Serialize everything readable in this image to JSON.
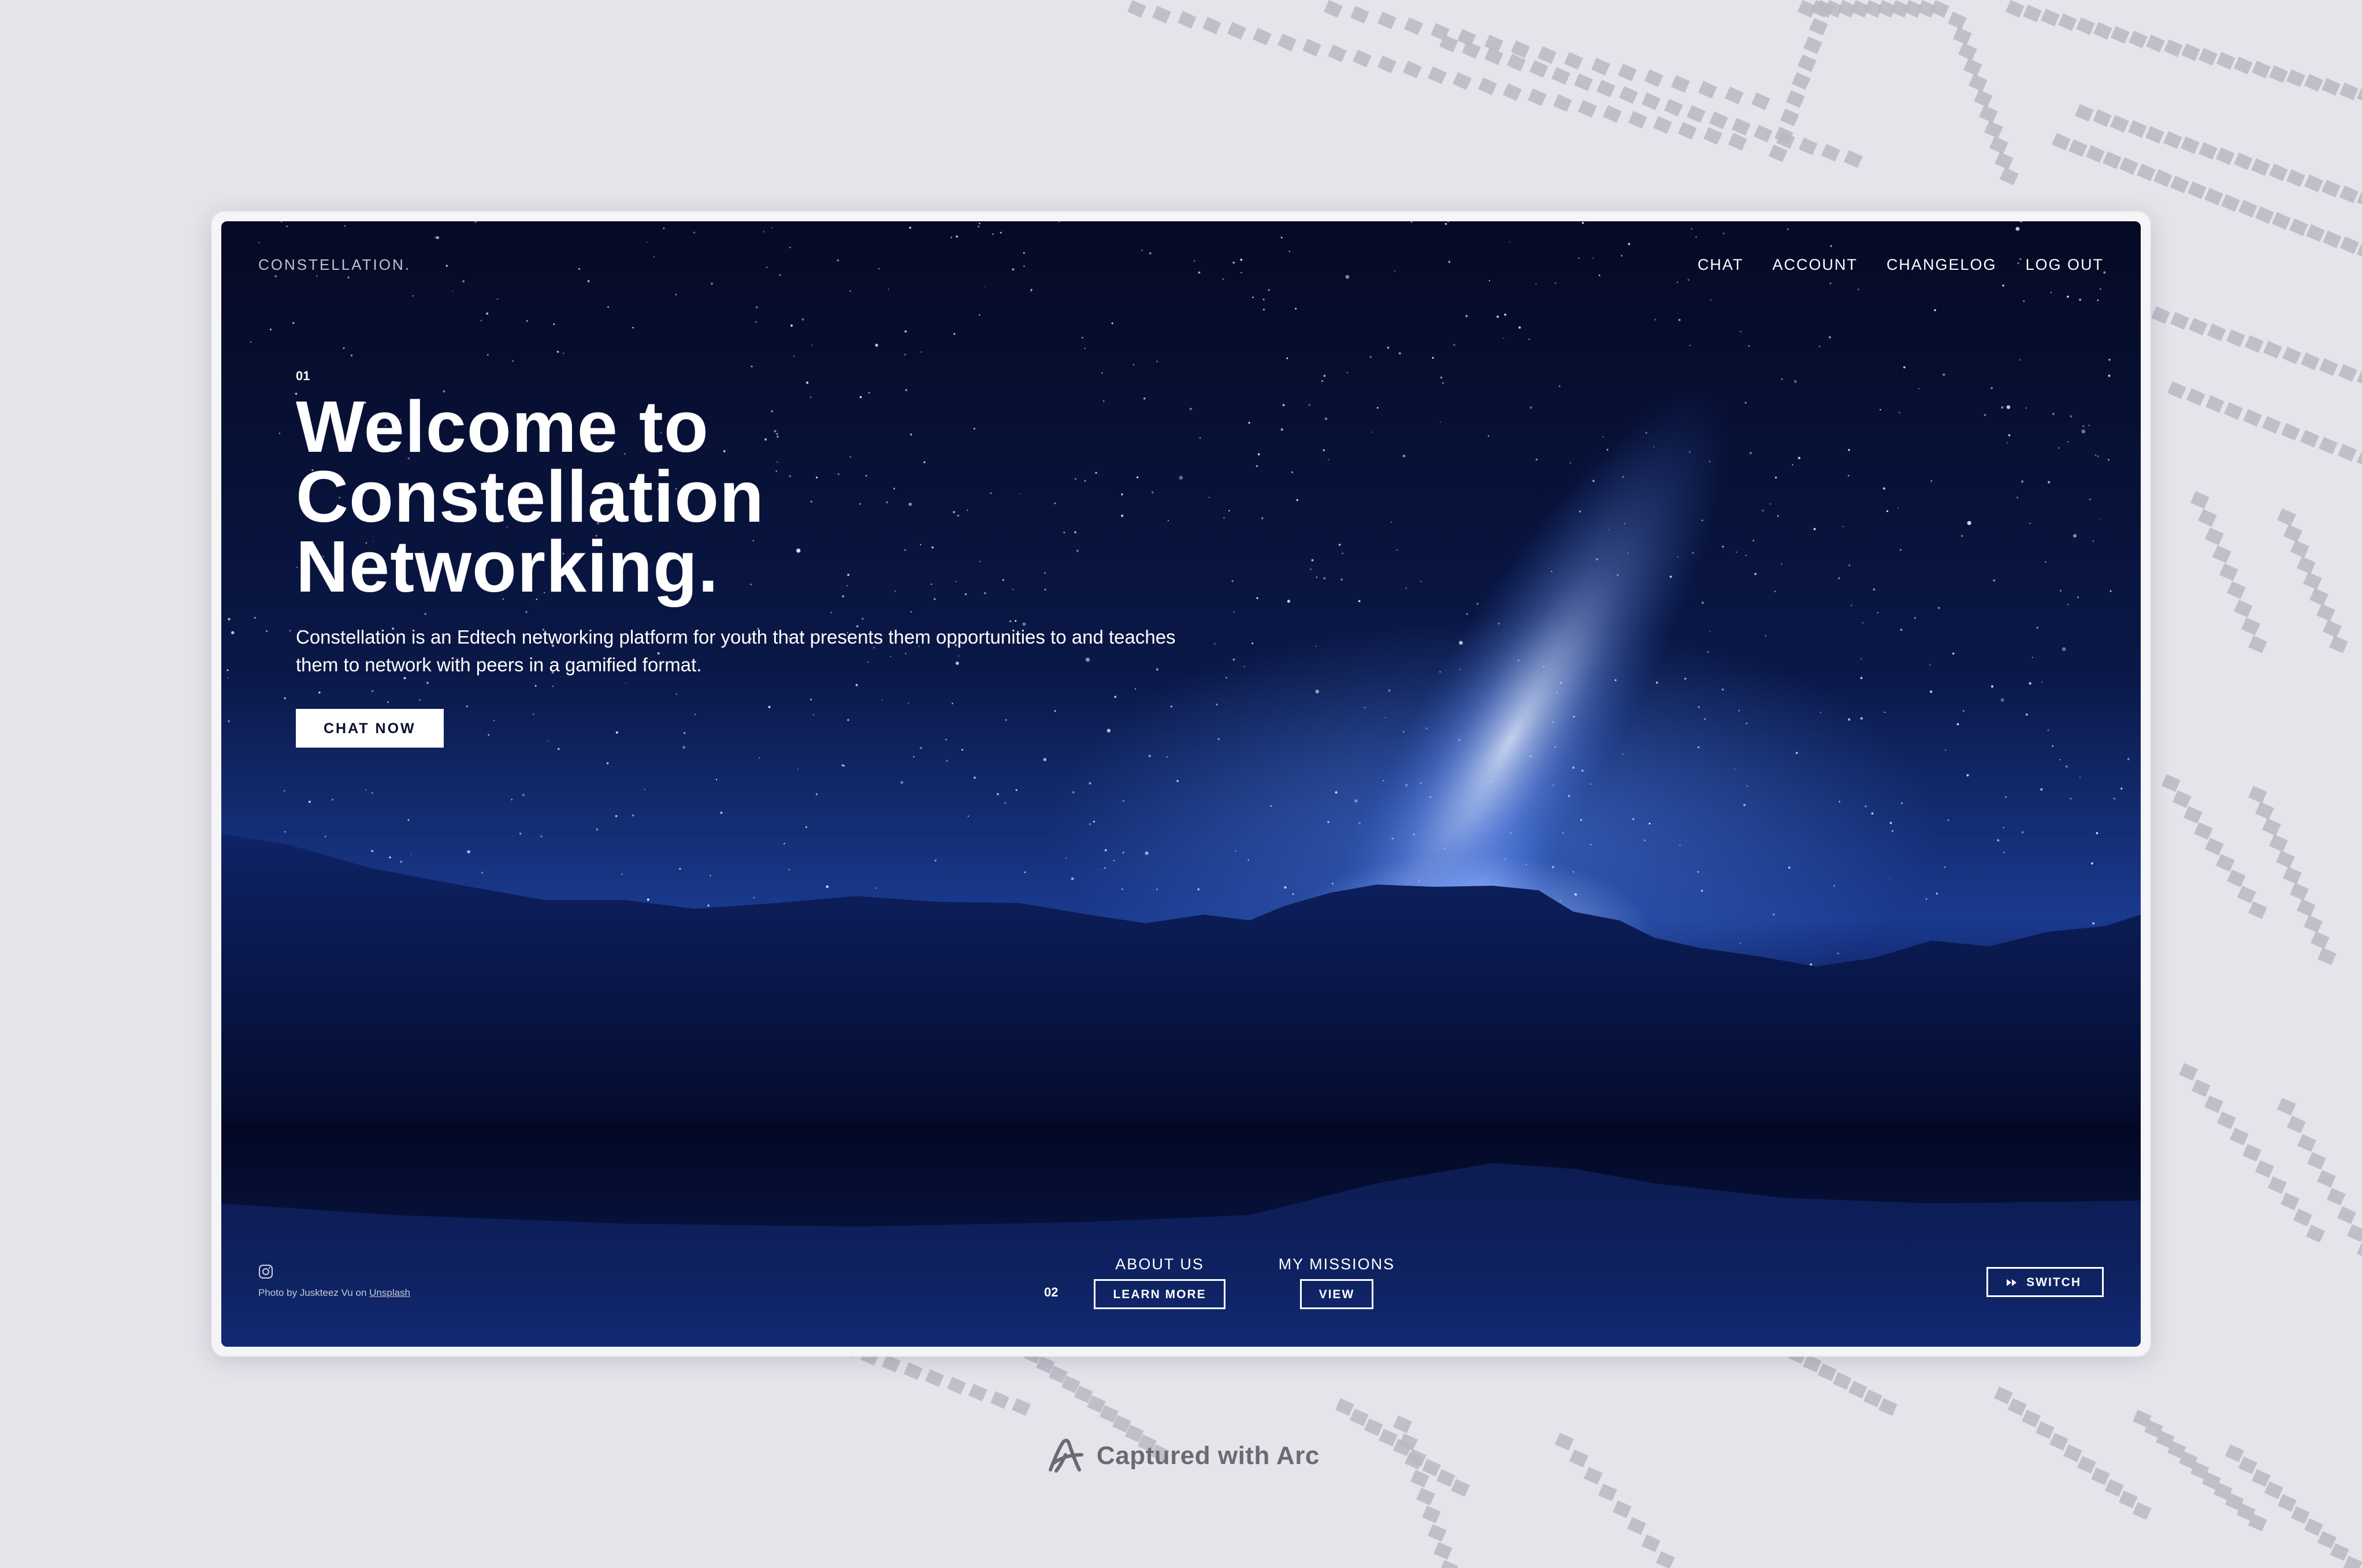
{
  "site": {
    "logo": "CONSTELLATION.",
    "nav": [
      "CHAT",
      "ACCOUNT",
      "CHANGELOG",
      "LOG OUT"
    ]
  },
  "hero": {
    "index": "01",
    "title": "Welcome to\nConstellation\nNetworking.",
    "description": "Constellation is an Edtech networking platform for youth that presents them opportunities to and teaches them to network with peers in a gamified format.",
    "cta": "CHAT NOW"
  },
  "footer": {
    "credit_prefix": "Photo by Juskteez Vu on ",
    "credit_link": "Unsplash",
    "section_index": "02",
    "about": {
      "label": "ABOUT US",
      "button": "LEARN MORE"
    },
    "missions": {
      "label": "MY MISSIONS",
      "button": "VIEW"
    },
    "switch": "SWITCH"
  },
  "capture_badge": "Captured with Arc",
  "icons": [
    "instagram-icon",
    "fast-forward-icon",
    "arc-logo-icon"
  ],
  "colors": {
    "page_bg": "#e4e4ea",
    "sky_deep": "#050a24",
    "sky_glow": "#1a3a8f",
    "text": "#ffffff"
  }
}
